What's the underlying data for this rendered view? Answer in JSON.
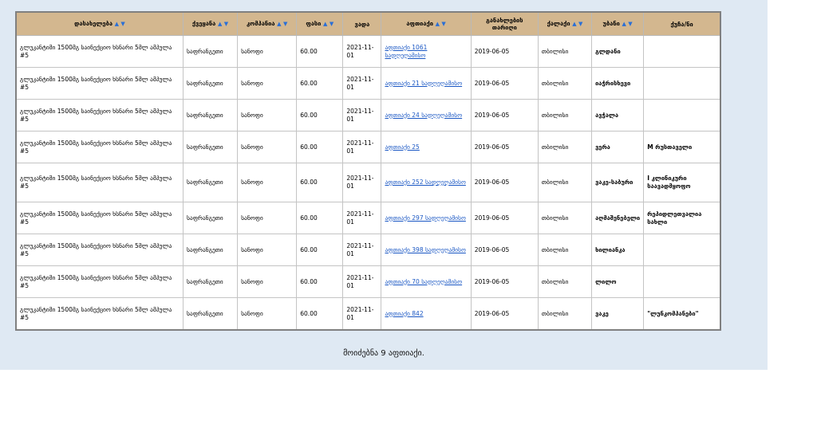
{
  "columns": [
    {
      "label": "დასახელება",
      "sortable": true
    },
    {
      "label": "ქვეყანა",
      "sortable": true
    },
    {
      "label": "კომპანია",
      "sortable": true
    },
    {
      "label": "ფასი",
      "sortable": true
    },
    {
      "label": "ვადა",
      "sortable": false
    },
    {
      "label": "აფთიაქი",
      "sortable": true
    },
    {
      "label": "განახლების თარიღი",
      "sortable": false
    },
    {
      "label": "ქალაქი",
      "sortable": true
    },
    {
      "label": "უბანი",
      "sortable": true
    },
    {
      "label": "ქუჩა/ნი",
      "sortable": false
    }
  ],
  "sort_arrows": "▲ ▼",
  "rows": [
    {
      "name": "გლუკანტიმი 1500მგ საინექციო ხსნარი 5მლ ამპულა #5",
      "country": "საფრანგეთი",
      "company": "სანოფი",
      "price": "60.00",
      "expiry": "2021-11-01",
      "pharmacy": "აფთიაქი 1061 სადღეღამისო",
      "updated": "2019-06-05",
      "city": "თბილისი",
      "district": "გლდანი",
      "street": "",
      "tall": false
    },
    {
      "name": "გლუკანტიმი 1500მგ საინექციო ხსნარი 5მლ ამპულა #5",
      "country": "საფრანგეთი",
      "company": "სანოფი",
      "price": "60.00",
      "expiry": "2021-11-01",
      "pharmacy": "აფთიაქი 21 სადღეღამისო",
      "updated": "2019-06-05",
      "city": "თბილისი",
      "district": "იაჭრისხევი",
      "street": "",
      "tall": false
    },
    {
      "name": "გლუკანტიმი 1500მგ საინექციო ხსნარი 5მლ ამპულა #5",
      "country": "საფრანგეთი",
      "company": "სანოფი",
      "price": "60.00",
      "expiry": "2021-11-01",
      "pharmacy": "აფთიაქი 24 სადღეღამისო",
      "updated": "2019-06-05",
      "city": "თბილისი",
      "district": "ავჭალა",
      "street": "",
      "tall": false
    },
    {
      "name": "გლუკანტიმი 1500მგ საინექციო ხსნარი 5მლ ამპულა #5",
      "country": "საფრანგეთი",
      "company": "სანოფი",
      "price": "60.00",
      "expiry": "2021-11-01",
      "pharmacy": "აფთიაქი 25",
      "updated": "2019-06-05",
      "city": "თბილისი",
      "district": "ვერა",
      "street": "M რუსთაველი",
      "tall": false
    },
    {
      "name": "გლუკანტიმი 1500მგ საინექციო ხსნარი 5მლ ამპულა #5",
      "country": "საფრანგეთი",
      "company": "სანოფი",
      "price": "60.00",
      "expiry": "2021-11-01",
      "pharmacy": "აფთიაქი 252 სადღეღამისო",
      "updated": "2019-06-05",
      "city": "თბილისი",
      "district": "ვაკე-საბური",
      "street": "I კლინიკური საავადმყოფო",
      "tall": true
    },
    {
      "name": "გლუკანტიმი 1500მგ საინექციო ხსნარი 5მლ ამპულა #5",
      "country": "საფრანგეთი",
      "company": "სანოფი",
      "price": "60.00",
      "expiry": "2021-11-01",
      "pharmacy": "აფთიაქი 297 სადღეღამისო",
      "updated": "2019-06-05",
      "city": "თბილისი",
      "district": "აღმაშენებელი",
      "street": "რეპიდლეთვალია სახლი",
      "tall": false
    },
    {
      "name": "გლუკანტიმი 1500მგ საინექციო ხსნარი 5მლ ამპულა #5",
      "country": "საფრანგეთი",
      "company": "სანოფი",
      "price": "60.00",
      "expiry": "2021-11-01",
      "pharmacy": "აფთიაქი 398 სადღეღამისო",
      "updated": "2019-06-05",
      "city": "თბილისი",
      "district": "ხილიანკა",
      "street": "",
      "tall": false
    },
    {
      "name": "გლუკანტიმი 1500მგ საინექციო ხსნარი 5მლ ამპულა #5",
      "country": "საფრანგეთი",
      "company": "სანოფი",
      "price": "60.00",
      "expiry": "2021-11-01",
      "pharmacy": "აფთიაქი 70 სადღეღამისო",
      "updated": "2019-06-05",
      "city": "თბილისი",
      "district": "ლილო",
      "street": "",
      "tall": false
    },
    {
      "name": "გლუკანტიმი 1500მგ საინექციო ხსნარი 5მლ ამპულა #5",
      "country": "საფრანგეთი",
      "company": "სანოფი",
      "price": "60.00",
      "expiry": "2021-11-01",
      "pharmacy": "აფთიაქი 842",
      "updated": "2019-06-05",
      "city": "თბილისი",
      "district": "ვაკე",
      "street": "\"ლუნკომპანები\"",
      "tall": false
    }
  ],
  "footer": "მოიძებნა 9 აფთიაქი."
}
